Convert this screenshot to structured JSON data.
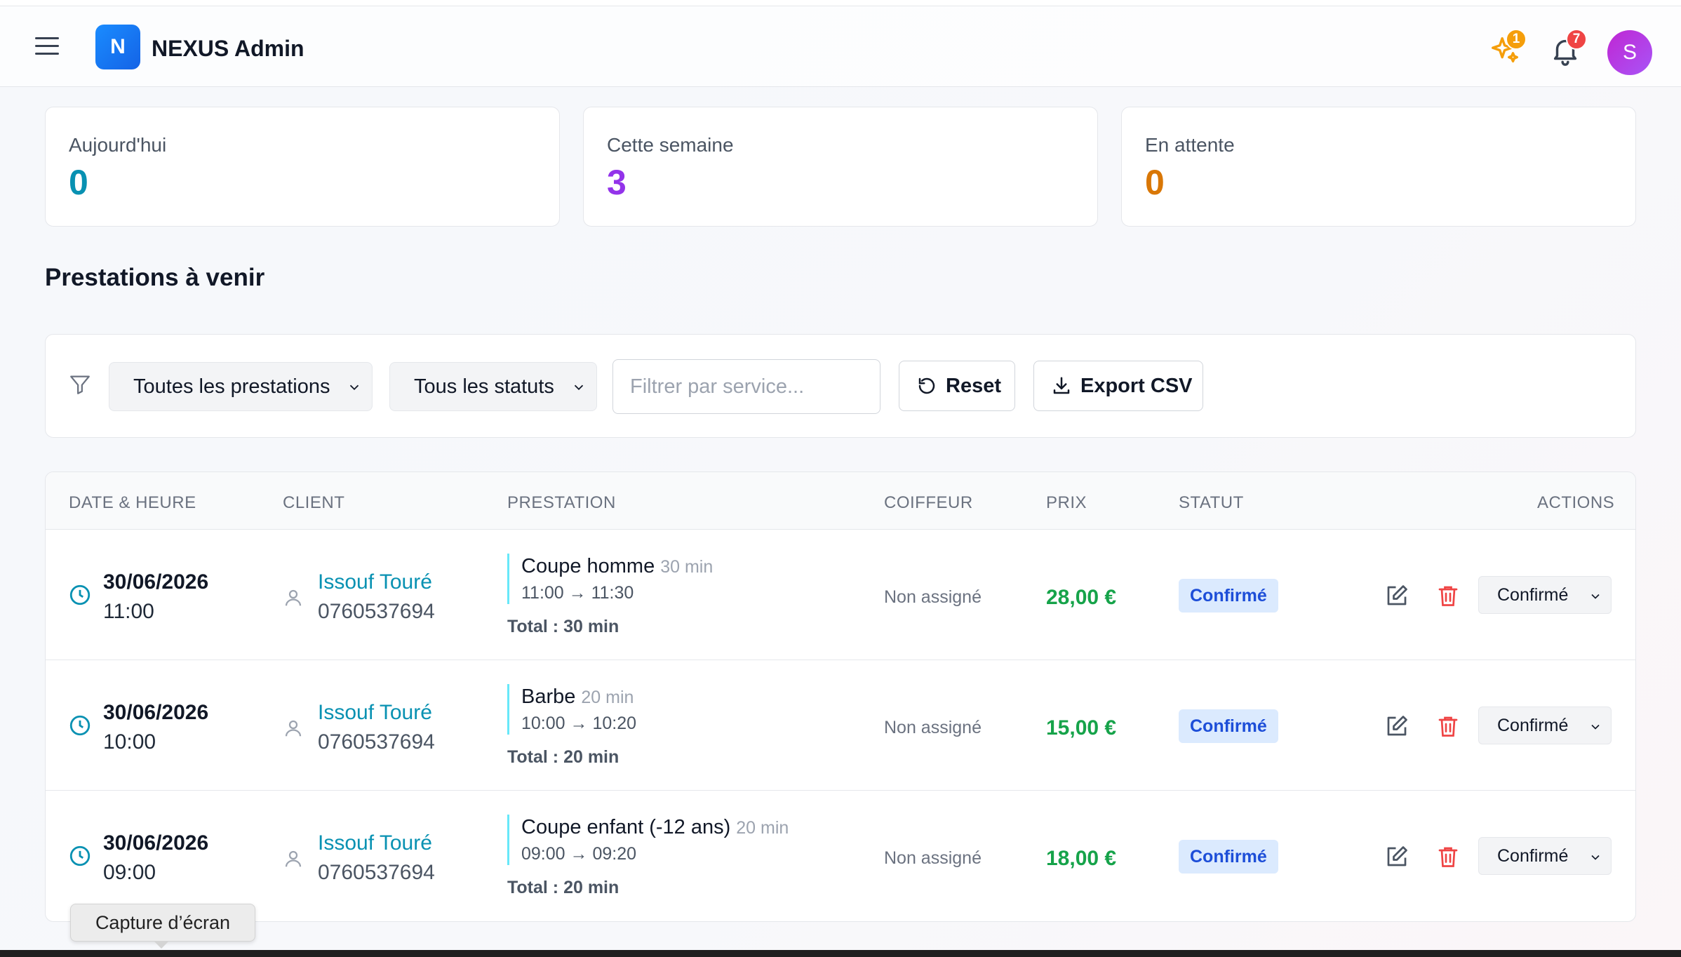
{
  "header": {
    "logo_letter": "N",
    "app_title": "NEXUS Admin",
    "sparkle_badge": "1",
    "bell_badge": "7",
    "avatar_letter": "S",
    "colors": {
      "sparkle_badge": "#f59e0b",
      "bell_badge": "#ef4444",
      "accent": "#1463e6"
    }
  },
  "stats": [
    {
      "label": "Aujourd'hui",
      "value": "0",
      "color": "#0891b2"
    },
    {
      "label": "Cette semaine",
      "value": "3",
      "color": "#9333ea"
    },
    {
      "label": "En attente",
      "value": "0",
      "color": "#d97706"
    }
  ],
  "section_title": "Prestations à venir",
  "filters": {
    "service_select": "Toutes les prestations",
    "status_select": "Tous les statuts",
    "search_placeholder": "Filtrer par service...",
    "reset_label": "Reset",
    "export_label": "Export CSV"
  },
  "table": {
    "columns": [
      "DATE & HEURE",
      "CLIENT",
      "PRESTATION",
      "COIFFEUR",
      "PRIX",
      "STATUT",
      "ACTIONS"
    ],
    "rows": [
      {
        "date": "30/06/2026",
        "time": "11:00",
        "client_name": "Issouf Touré",
        "client_phone": "0760537694",
        "service": "Coupe homme",
        "duration": "30 min",
        "range": "11:00 → 11:30",
        "total": "Total : 30 min",
        "coiffeur": "Non assigné",
        "price": "28,00 €",
        "status": "Confirmé",
        "status_select": "Confirmé"
      },
      {
        "date": "30/06/2026",
        "time": "10:00",
        "client_name": "Issouf Touré",
        "client_phone": "0760537694",
        "service": "Barbe",
        "duration": "20 min",
        "range": "10:00 → 10:20",
        "total": "Total : 20 min",
        "coiffeur": "Non assigné",
        "price": "15,00 €",
        "status": "Confirmé",
        "status_select": "Confirmé"
      },
      {
        "date": "30/06/2026",
        "time": "09:00",
        "client_name": "Issouf Touré",
        "client_phone": "0760537694",
        "service": "Coupe enfant (-12 ans)",
        "duration": "20 min",
        "range": "09:00 → 09:20",
        "total": "Total : 20 min",
        "coiffeur": "Non assigné",
        "price": "18,00 €",
        "status": "Confirmé",
        "status_select": "Confirmé"
      }
    ]
  },
  "tooltip": "Capture d’écran"
}
